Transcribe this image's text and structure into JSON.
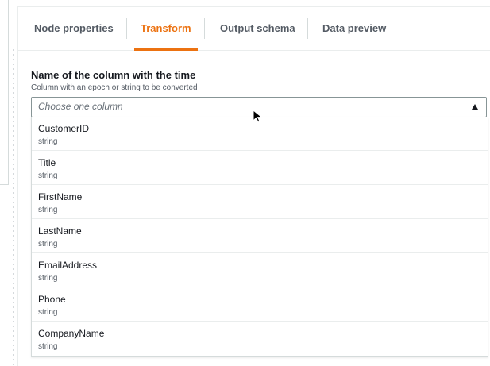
{
  "tabs": [
    {
      "label": "Node properties"
    },
    {
      "label": "Transform"
    },
    {
      "label": "Output schema"
    },
    {
      "label": "Data preview"
    }
  ],
  "active_tab": "Transform",
  "accent_color": "#ec7211",
  "field": {
    "label": "Name of the column with the time",
    "description": "Column with an epoch or string to be converted",
    "placeholder": "Choose one column"
  },
  "options": [
    {
      "name": "CustomerID",
      "type": "string"
    },
    {
      "name": "Title",
      "type": "string"
    },
    {
      "name": "FirstName",
      "type": "string"
    },
    {
      "name": "LastName",
      "type": "string"
    },
    {
      "name": "EmailAddress",
      "type": "string"
    },
    {
      "name": "Phone",
      "type": "string"
    },
    {
      "name": "CompanyName",
      "type": "string"
    }
  ],
  "icons": {
    "dropdown": "caret-up-icon",
    "pointer": "mouse-pointer-icon"
  }
}
